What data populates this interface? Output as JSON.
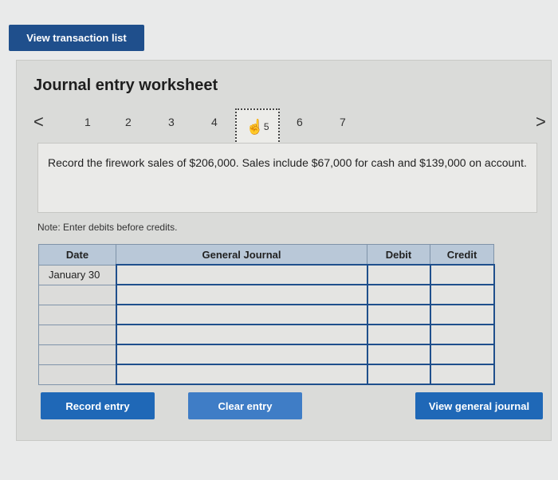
{
  "toolbar": {
    "view_transaction_list": "View transaction list"
  },
  "worksheet": {
    "title": "Journal entry worksheet",
    "nav": {
      "prev": "<",
      "next": ">",
      "steps": [
        "1",
        "2",
        "3",
        "4",
        "5",
        "6",
        "7"
      ],
      "current_step": "5"
    },
    "question": "Record the firework sales of $206,000. Sales include $67,000 for cash and $139,000 on account.",
    "note": "Note: Enter debits before credits.",
    "table": {
      "headers": [
        "Date",
        "General Journal",
        "Debit",
        "Credit"
      ],
      "rows": [
        {
          "date": "January 30",
          "account": "",
          "debit": "",
          "credit": ""
        },
        {
          "date": "",
          "account": "",
          "debit": "",
          "credit": ""
        },
        {
          "date": "",
          "account": "",
          "debit": "",
          "credit": ""
        },
        {
          "date": "",
          "account": "",
          "debit": "",
          "credit": ""
        },
        {
          "date": "",
          "account": "",
          "debit": "",
          "credit": ""
        },
        {
          "date": "",
          "account": "",
          "debit": "",
          "credit": ""
        }
      ]
    },
    "buttons": {
      "record_entry": "Record entry",
      "clear_entry": "Clear entry",
      "view_general_journal": "View general journal"
    }
  },
  "colors": {
    "primary": "#1f4f8c",
    "button": "#1f68b7",
    "header_bg": "#b9c8d8"
  }
}
